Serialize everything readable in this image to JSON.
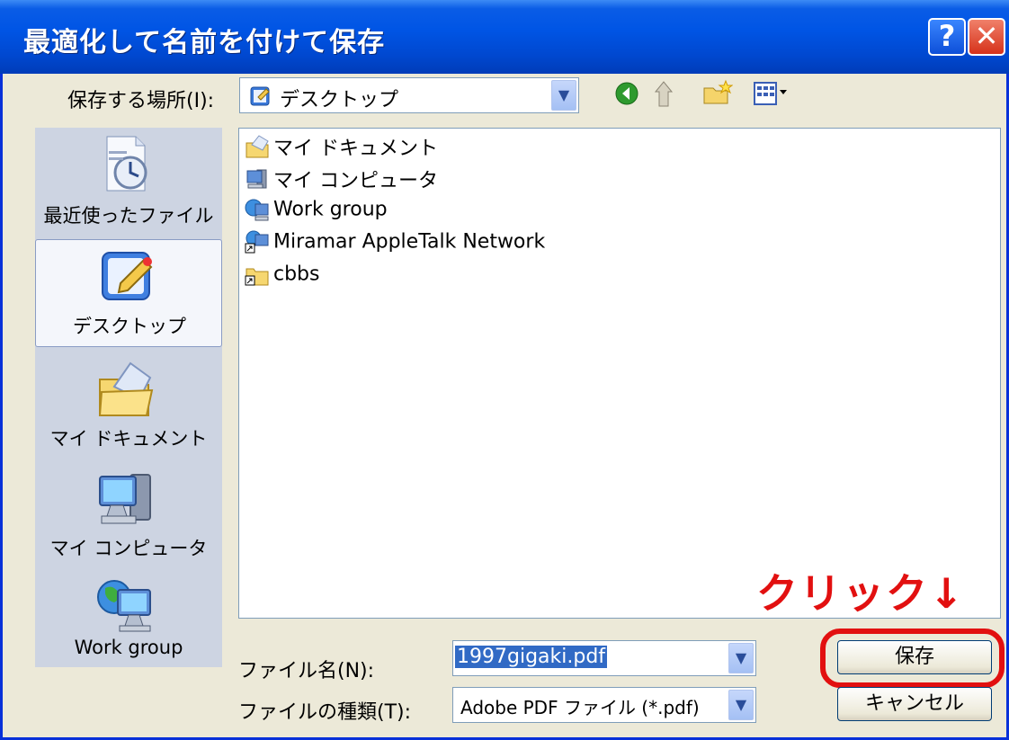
{
  "dialog": {
    "title": "最適化して名前を付けて保存",
    "help_glyph": "?",
    "close_glyph": "✕"
  },
  "location": {
    "label": "保存する場所(I):",
    "value": "デスクトップ"
  },
  "places": [
    {
      "label": "最近使ったファイル",
      "icon": "recent-files-icon"
    },
    {
      "label": "デスクトップ",
      "icon": "desktop-icon",
      "selected": true
    },
    {
      "label": "マイ ドキュメント",
      "icon": "my-documents-icon"
    },
    {
      "label": "マイ コンピュータ",
      "icon": "my-computer-icon"
    },
    {
      "label": "Work group",
      "icon": "network-globe-icon"
    }
  ],
  "files": [
    {
      "name": "マイ ドキュメント",
      "icon": "my-documents-icon"
    },
    {
      "name": "マイ コンピュータ",
      "icon": "my-computer-icon"
    },
    {
      "name": "Work group",
      "icon": "network-icon"
    },
    {
      "name": "Miramar AppleTalk Network",
      "icon": "network-shortcut-icon"
    },
    {
      "name": "cbbs",
      "icon": "folder-shortcut-icon"
    }
  ],
  "filename": {
    "label": "ファイル名(N):",
    "value": "1997gigaki.pdf"
  },
  "filetype": {
    "label": "ファイルの種類(T):",
    "value": "Adobe PDF ファイル (*.pdf)"
  },
  "buttons": {
    "save": "保存",
    "cancel": "キャンセル"
  },
  "annotation": {
    "text": "クリック↓",
    "color": "#e21010"
  },
  "colors": {
    "titlebar": "#0055e5",
    "dialog_bg": "#ece9d8",
    "places_bar": "#cdd4e2",
    "selection": "#316ac5"
  }
}
